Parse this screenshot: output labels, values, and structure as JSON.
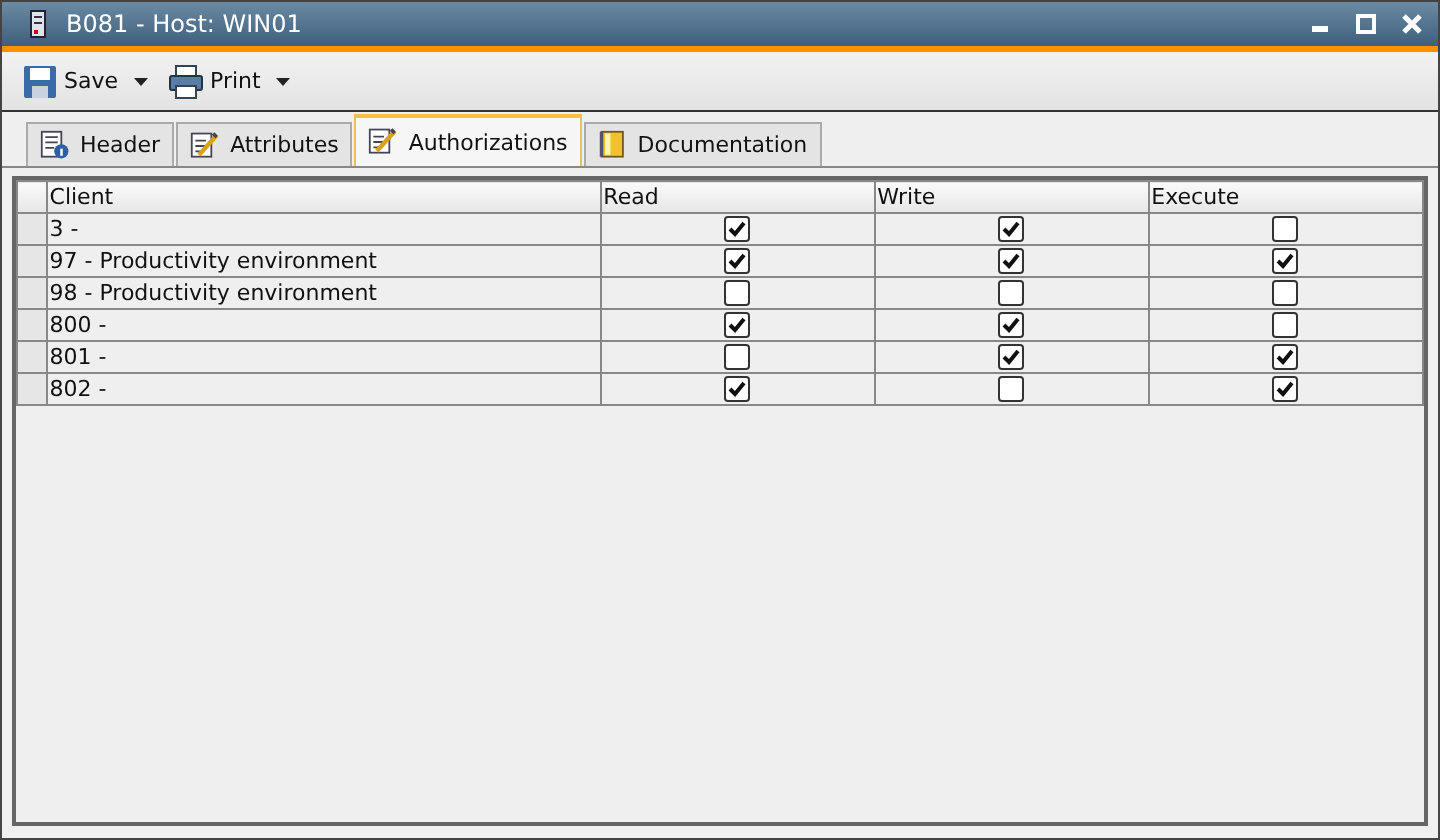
{
  "window": {
    "title": "B081 - Host: WIN01"
  },
  "toolbar": [
    {
      "label": "Save",
      "kind": "save"
    },
    {
      "label": "Print",
      "kind": "print"
    }
  ],
  "tabs": [
    {
      "label": "Header",
      "kind": "info",
      "selected": false
    },
    {
      "label": "Attributes",
      "kind": "edit",
      "selected": false
    },
    {
      "label": "Authorizations",
      "kind": "edit",
      "selected": true
    },
    {
      "label": "Documentation",
      "kind": "book",
      "selected": false
    }
  ],
  "table": {
    "columns": [
      "Client",
      "Read",
      "Write",
      "Execute"
    ],
    "rows": [
      {
        "client": "3 -",
        "read": true,
        "write": true,
        "execute": false
      },
      {
        "client": "97 - Productivity environment",
        "read": true,
        "write": true,
        "execute": true
      },
      {
        "client": "98 - Productivity environment",
        "read": false,
        "write": false,
        "execute": false
      },
      {
        "client": "800 -",
        "read": true,
        "write": true,
        "execute": false
      },
      {
        "client": "801 -",
        "read": false,
        "write": true,
        "execute": true
      },
      {
        "client": "802 -",
        "read": true,
        "write": false,
        "execute": true
      }
    ]
  }
}
